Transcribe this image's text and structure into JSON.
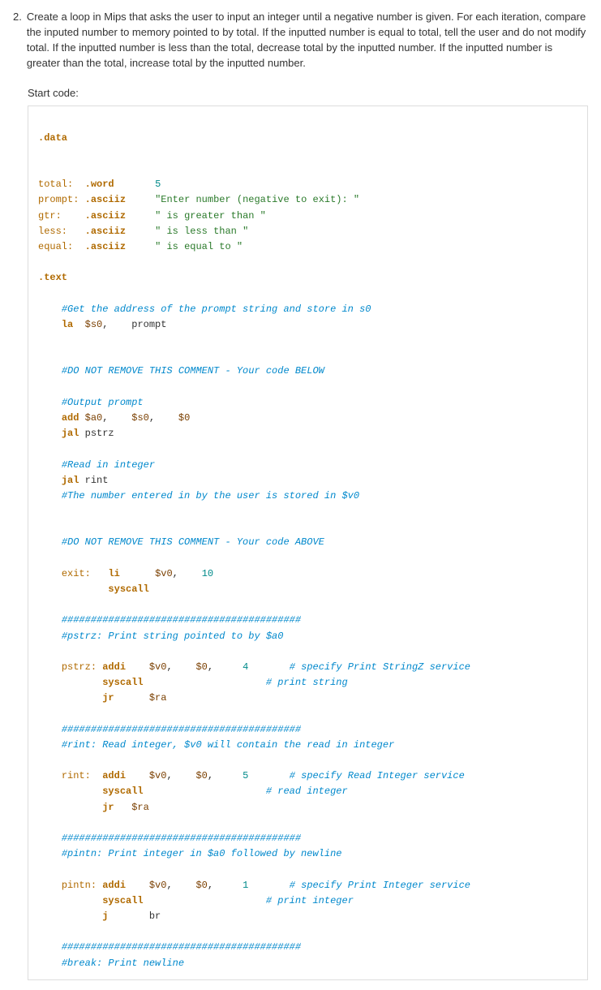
{
  "question_number": "2.",
  "question_text": "Create a loop in Mips that asks the user to input an integer until a negative number is given. For each iteration, compare the inputed number to memory pointed to by total. If the inputted number is equal to total, tell the user and do not modify total. If the inputted number is less than the total, decrease total by the inputted number. If the inputted number is greater than the total, increase total by the inputted number.",
  "start_label": "Start code:",
  "code": {
    "l00": ".data",
    "l01_lbl": "total:",
    "l01_dir": ".word",
    "l01_v": "5",
    "l02_lbl": "prompt:",
    "l02_dir": ".asciiz",
    "l02_v": "\"Enter number (negative to exit): \"",
    "l03_lbl": "gtr:",
    "l03_dir": ".asciiz",
    "l03_v": "\" is greater than \"",
    "l04_lbl": "less:",
    "l04_dir": ".asciiz",
    "l04_v": "\" is less than \"",
    "l05_lbl": "equal:",
    "l05_dir": ".asciiz",
    "l05_v": "\" is equal to \"",
    "l06": ".text",
    "c01": "#Get the address of the prompt string and store in s0",
    "l07_ins": "la",
    "l07_r1": "$s0",
    "l07_arg": "prompt",
    "c02": "#DO NOT REMOVE THIS COMMENT - Your code BELOW",
    "c03": "#Output prompt",
    "l08_ins": "add",
    "l08_r1": "$a0",
    "l08_r2": "$s0",
    "l08_r3": "$0",
    "l09_ins": "jal",
    "l09_arg": "pstrz",
    "c04": "#Read in integer",
    "l10_ins": "jal",
    "l10_arg": "rint",
    "c05": "#The number entered in by the user is stored in $v0",
    "c06": "#DO NOT REMOVE THIS COMMENT - Your code ABOVE",
    "l11_lbl": "exit:",
    "l11_ins": "li",
    "l11_r1": "$v0",
    "l11_v": "10",
    "l12_ins": "syscall",
    "c07": "#########################################",
    "c08": "#pstrz: Print string pointed to by $a0",
    "l13_lbl": "pstrz:",
    "l13_ins": "addi",
    "l13_r1": "$v0",
    "l13_r2": "$0",
    "l13_v": "4",
    "c09": "# specify Print StringZ service",
    "l14_ins": "syscall",
    "c10": "# print string",
    "l15_ins": "jr",
    "l15_r1": "$ra",
    "c11": "#########################################",
    "c12": "#rint: Read integer, $v0 will contain the read in integer",
    "l16_lbl": "rint:",
    "l16_ins": "addi",
    "l16_r1": "$v0",
    "l16_r2": "$0",
    "l16_v": "5",
    "c13": "# specify Read Integer service",
    "l17_ins": "syscall",
    "c14": "# read integer",
    "l18_ins": "jr",
    "l18_r1": "$ra",
    "c15": "#########################################",
    "c16": "#pintn: Print integer in $a0 followed by newline",
    "l19_lbl": "pintn:",
    "l19_ins": "addi",
    "l19_r1": "$v0",
    "l19_r2": "$0",
    "l19_v": "1",
    "c17": "# specify Print Integer service",
    "l20_ins": "syscall",
    "c18": "# print integer",
    "l21_ins": "j",
    "l21_arg": "br",
    "c19": "#########################################",
    "c20": "#break: Print newline"
  }
}
